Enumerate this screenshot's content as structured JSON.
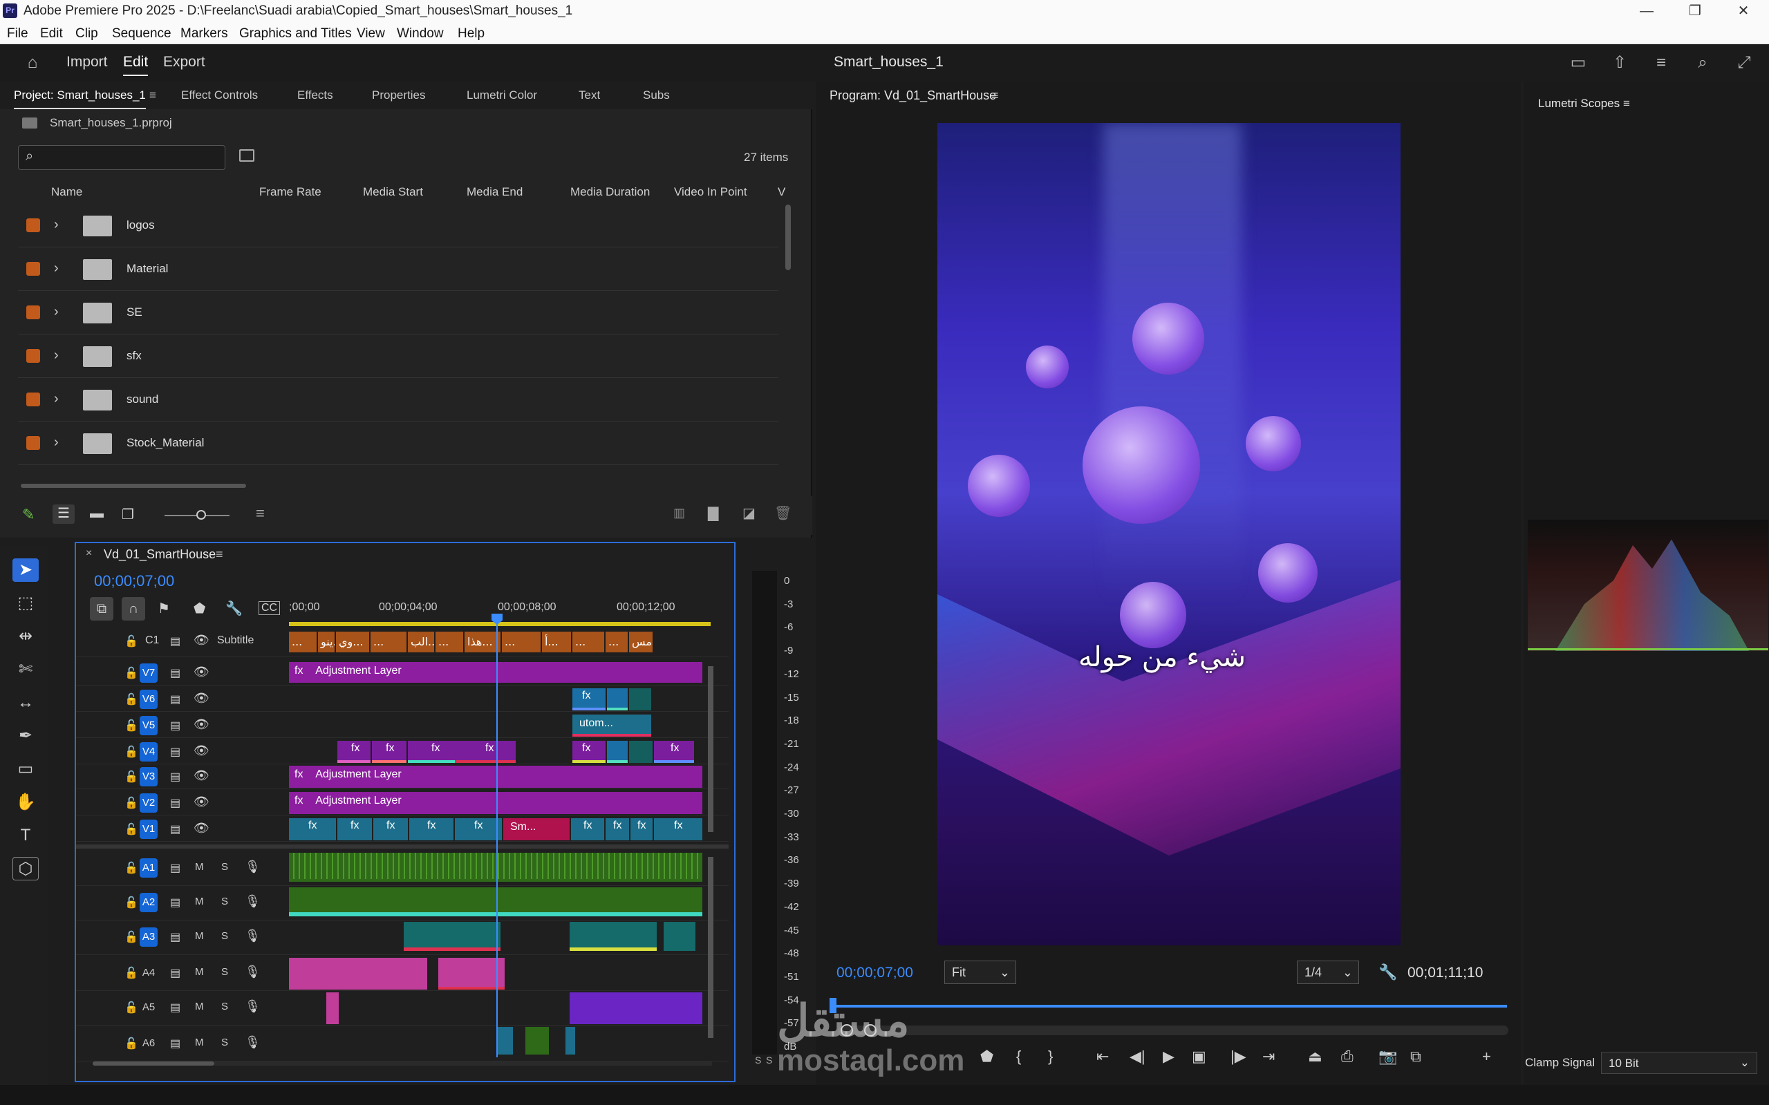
{
  "titlebar": {
    "title": "Adobe Premiere Pro 2025 - D:\\Freelanc\\Suadi arabia\\Copied_Smart_houses\\Smart_houses_1",
    "app_icon": "Pr",
    "minimize": "—",
    "maximize": "❐",
    "close": "✕"
  },
  "menu": [
    "File",
    "Edit",
    "Clip",
    "Sequence",
    "Markers",
    "Graphics and Titles",
    "View",
    "Window",
    "Help"
  ],
  "header": {
    "home": "⌂",
    "workspaces": [
      "Import",
      "Edit",
      "Export"
    ],
    "active_workspace": "Edit",
    "project_title": "Smart_houses_1"
  },
  "project": {
    "tabs": [
      "Project: Smart_houses_1",
      "Effect Controls",
      "Effects",
      "Properties",
      "Lumetri Color",
      "Text",
      "Subs"
    ],
    "file": "Smart_houses_1.prproj",
    "search_placeholder": "",
    "item_count": "27 items",
    "columns": [
      "Name",
      "Frame Rate",
      "Media Start",
      "Media End",
      "Media Duration",
      "Video In Point",
      "V"
    ],
    "folders": [
      "logos",
      "Material",
      "SE",
      "sfx",
      "sound",
      "Stock_Material"
    ],
    "label_color": "#c25a1b"
  },
  "timeline": {
    "sequence": "Vd_01_SmartHouse",
    "timecode": "00;00;07;00",
    "ruler": [
      ";00;00",
      "00;00;04;00",
      "00;00;08;00",
      "00;00;12;00"
    ],
    "caption_track": {
      "name": "C1",
      "label": "Subtitle",
      "clips": [
        "...",
        "ينو...",
        "وي...",
        "...",
        "الب...",
        "...",
        "هذا...",
        "...",
        "أ...",
        "...",
        "...",
        "مس..."
      ]
    },
    "video_tracks": [
      "V7",
      "V6",
      "V5",
      "V4",
      "V3",
      "V2",
      "V1"
    ],
    "audio_tracks": [
      "A1",
      "A2",
      "A3",
      "A4",
      "A5",
      "A6"
    ],
    "adjustment_label": "Adjustment Layer",
    "fx_label": "fx",
    "clip_labels": {
      "automation": "utom...",
      "smart": "Sm..."
    },
    "audio_buttons": {
      "mute": "M",
      "solo": "S"
    }
  },
  "meter": {
    "scale": [
      "0",
      "-3",
      "-6",
      "-9",
      "-12",
      "-15",
      "-18",
      "-21",
      "-24",
      "-27",
      "-30",
      "-33",
      "-36",
      "-39",
      "-42",
      "-45",
      "-48",
      "-51",
      "-54",
      "-57",
      "dB"
    ],
    "solo_labels": [
      "S",
      "S"
    ]
  },
  "program": {
    "title": "Program: Vd_01_SmartHouse",
    "subtitle": "شيء من حوله",
    "timecode": "00;00;07;00",
    "fit": "Fit",
    "resolution": "1/4",
    "duration": "00;01;11;10",
    "playhead_fraction": 0.098
  },
  "scopes": {
    "title": "Lumetri Scopes",
    "clamp": "Clamp Signal",
    "bit_depth": "10 Bit"
  },
  "watermark": {
    "arabic": "مستقل",
    "latin": "mostaql.com"
  }
}
